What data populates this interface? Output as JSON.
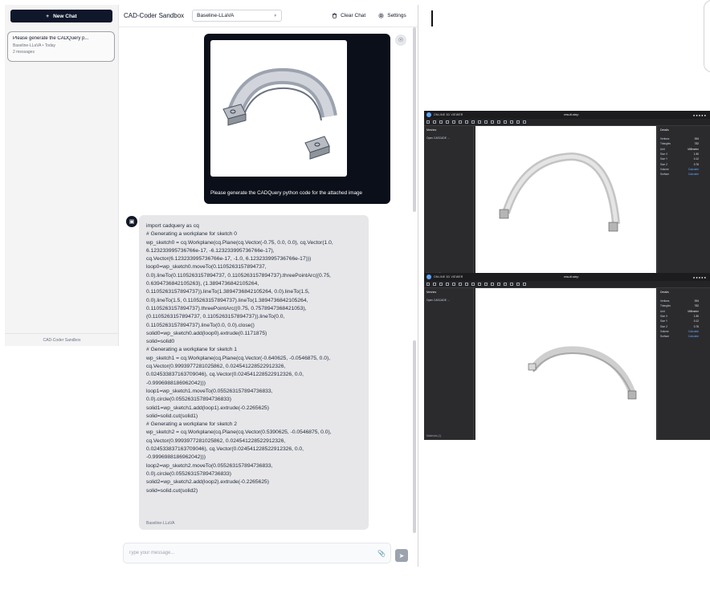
{
  "sidebar": {
    "new_chat": "New Chat",
    "chat_item": {
      "title": "Please generate the CADQuery p...",
      "model": "Baseline-LLaVA",
      "sep": "•",
      "date": "Today",
      "count": "2 messages"
    },
    "footer": "CAD-Coder Sandbox"
  },
  "header": {
    "title": "CAD-Coder Sandbox",
    "model": "Baseline-LLaVA",
    "clear": "Clear Chat",
    "settings": "Settings"
  },
  "user_message": {
    "text": "Please generate the CADQuery python code for the attached image"
  },
  "bot_message": {
    "lines": [
      "import cadquery as cq",
      "# Generating a workplane for sketch 0",
      "wp_sketch0 = cq.Workplane(cq.Plane(cq.Vector(-0.75, 0.0, 0.0), cq.Vector(1.0,",
      "6.123233995736766e-17, -6.123233995736766e-17),",
      "cq.Vector(6.123233995736766e-17, -1.0, 6.123233995736766e-17)))",
      "loop0=wp_sketch0.moveTo(0.1105263157894737,",
      "0.0).lineTo(0.1105263157894737, 0.1105263157894737).threePointArc((0.75,",
      "0.6394736842105263), (1.3894736842105264,",
      "0.1105263157894737)).lineTo(1.3894736842105264, 0.0).lineTo(1.5,",
      "0.0).lineTo(1.5, 0.1105263157894737).lineTo(1.3894736842105264,",
      "0.1105263157894737).threePointArc((0.75, 0.7578947368421053),",
      "(0.1105263157894737, 0.1105263157894737)).lineTo(0.0,",
      "0.1105263157894737).lineTo(0.0, 0.0).close()",
      "solid0=wp_sketch0.add(loop0).extrude(0.1171875)",
      "solid=solid0",
      "# Generating a workplane for sketch 1",
      "wp_sketch1 = cq.Workplane(cq.Plane(cq.Vector(-0.640625, -0.0546875, 0.0),",
      "cq.Vector(0.9993977281025862, 0.024541228522912326,",
      "0.024533837163709046), cq.Vector(0.024541228522912326, 0.0,",
      "-0.9996988186962042)))",
      "loop1=wp_sketch1.moveTo(0.055263157894736833,",
      "0.0).circle(0.055263157894736833)",
      "solid1=wp_sketch1.add(loop1).extrude(-0.2265625)",
      "solid=solid.cut(solid1)",
      "# Generating a workplane for sketch 2",
      "wp_sketch2 = cq.Workplane(cq.Plane(cq.Vector(0.5390625, -0.0546875, 0.0),",
      "cq.Vector(0.9993977281025862, 0.024541228522912326,",
      "0.024533837163709046), cq.Vector(0.024541228522912326, 0.0,",
      "-0.9996988186962042)))",
      "loop2=wp_sketch2.moveTo(0.055263157894736833,",
      "0.0).circle(0.055263157894736833)",
      "solid2=wp_sketch2.add(loop2).extrude(-0.2265625)",
      "solid=solid.cut(solid2)"
    ],
    "model": "Baseline-LLaVA"
  },
  "composer": {
    "placeholder": "Type your message..."
  },
  "viewers": [
    {
      "app": "ONLINE 3D VIEWER",
      "file": "result.step",
      "meshes_label": "Meshes",
      "mesh_item": "Open CASCADE ...",
      "materials": "Materials (1)",
      "details_label": "Details",
      "details": [
        {
          "k": "Vertices",
          "v": "394"
        },
        {
          "k": "Triangles",
          "v": "782"
        },
        {
          "k": "Unit",
          "v": "Millimeter"
        },
        {
          "k": "Size X",
          "v": "1.50"
        },
        {
          "k": "Size Y",
          "v": "0.12"
        },
        {
          "k": "Size Z",
          "v": "0.76"
        },
        {
          "k": "Volume",
          "v": "Calculate"
        },
        {
          "k": "Surface",
          "v": "Calculate"
        }
      ]
    },
    {
      "app": "ONLINE 3D VIEWER",
      "file": "result.step",
      "meshes_label": "Meshes",
      "mesh_item": "Open CASCADE ...",
      "materials": "Materials (1)",
      "details_label": "Details",
      "details": [
        {
          "k": "Vertices",
          "v": "394"
        },
        {
          "k": "Triangles",
          "v": "782"
        },
        {
          "k": "Unit",
          "v": "Millimeter"
        },
        {
          "k": "Size X",
          "v": "1.50"
        },
        {
          "k": "Size Y",
          "v": "0.12"
        },
        {
          "k": "Size Z",
          "v": "0.76"
        },
        {
          "k": "Volume",
          "v": "Calculate"
        },
        {
          "k": "Surface",
          "v": "Calculate"
        }
      ]
    }
  ],
  "colors": {
    "accent": "#0f172a",
    "link": "#60a5fa",
    "viewer_bg": "#2b2b2e"
  },
  "icons": [
    "plus-icon",
    "trash-icon",
    "gear-icon",
    "user-icon",
    "bot-icon",
    "paperclip-icon",
    "send-icon",
    "chevron-down-icon"
  ]
}
